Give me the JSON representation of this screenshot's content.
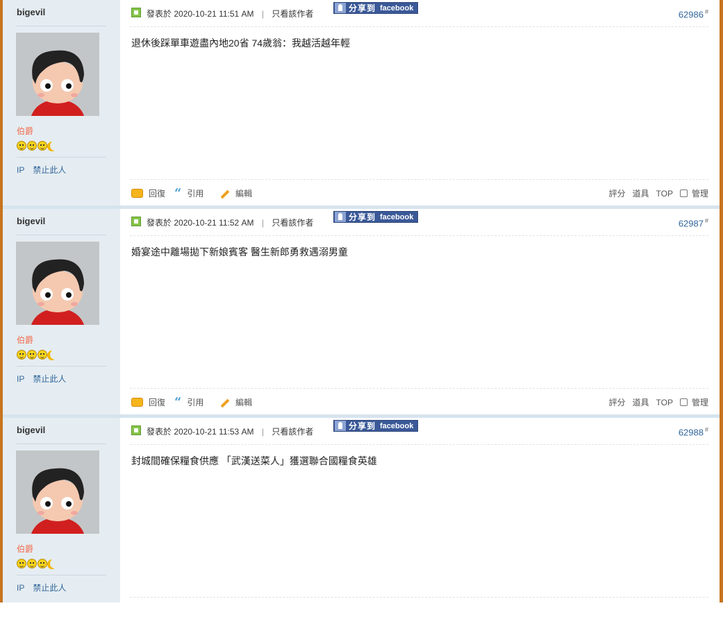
{
  "posts": [
    {
      "author": "bigevil",
      "rank": "伯爵",
      "side_links": [
        "IP",
        "禁止此人"
      ],
      "posted_label": "發表於",
      "timestamp": "2020-10-21 11:51 AM",
      "only_author": "只看該作者",
      "share_label": "分享到",
      "share_brand": "facebook",
      "post_number": "62986",
      "post_number_suffix": "#",
      "content": "退休後踩單車遊盡內地20省 74歲翁：我越活越年輕",
      "actions": {
        "reply": "回復",
        "quote": "引用",
        "edit": "編輯"
      },
      "right_actions": {
        "rate": "評分",
        "tools": "道具",
        "top": "TOP",
        "manage": "管理"
      }
    },
    {
      "author": "bigevil",
      "rank": "伯爵",
      "side_links": [
        "IP",
        "禁止此人"
      ],
      "posted_label": "發表於",
      "timestamp": "2020-10-21 11:52 AM",
      "only_author": "只看該作者",
      "share_label": "分享到",
      "share_brand": "facebook",
      "post_number": "62987",
      "post_number_suffix": "#",
      "content": "婚宴途中離場拋下新娘賓客 醫生新郎勇救遇溺男童",
      "actions": {
        "reply": "回復",
        "quote": "引用",
        "edit": "編輯"
      },
      "right_actions": {
        "rate": "評分",
        "tools": "道具",
        "top": "TOP",
        "manage": "管理"
      }
    },
    {
      "author": "bigevil",
      "rank": "伯爵",
      "side_links": [
        "IP",
        "禁止此人"
      ],
      "posted_label": "發表於",
      "timestamp": "2020-10-21 11:53 AM",
      "only_author": "只看該作者",
      "share_label": "分享到",
      "share_brand": "facebook",
      "post_number": "62988",
      "post_number_suffix": "#",
      "content": "封城間確保糧食供應 「武漢送菜人」獲選聯合國糧食英雄"
    }
  ],
  "colors": {
    "rank": "#f26c4f",
    "link": "#336699",
    "sidebar": "#e5edf2",
    "frame": "#c8741e",
    "facebook": "#3b5998"
  },
  "icons": [
    "green-post-icon",
    "facebook-share-icon",
    "reply-icon",
    "quote-icon",
    "edit-pencil-icon",
    "smiley-icon",
    "moon-icon",
    "checkbox-icon"
  ]
}
